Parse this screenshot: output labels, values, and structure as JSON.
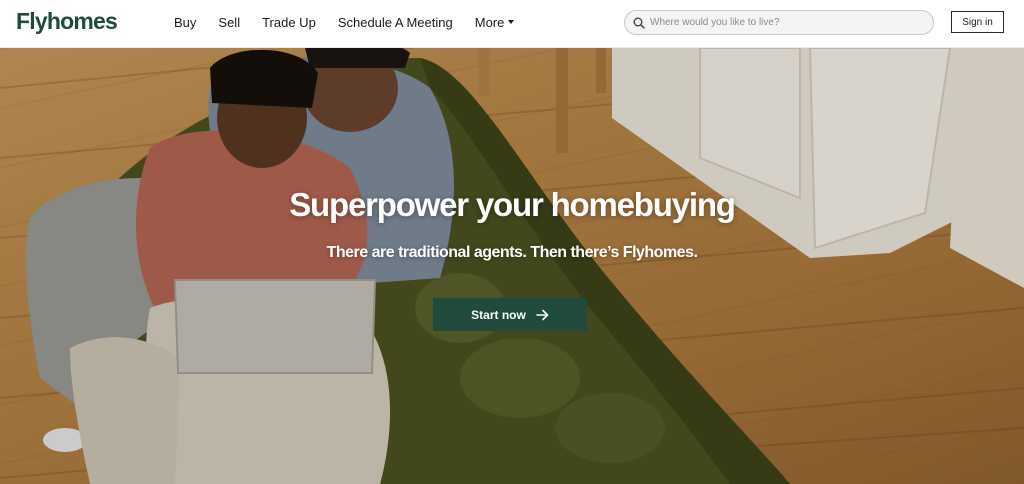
{
  "brand": {
    "name": "Flyhomes",
    "color": "#1f4a3c"
  },
  "nav": {
    "items": [
      {
        "label": "Buy"
      },
      {
        "label": "Sell"
      },
      {
        "label": "Trade Up"
      },
      {
        "label": "Schedule A Meeting"
      },
      {
        "label": "More",
        "has_dropdown": true
      }
    ]
  },
  "search": {
    "placeholder": "Where would you like to live?",
    "icon": "search-icon"
  },
  "auth": {
    "signin_label": "Sign in"
  },
  "hero": {
    "title": "Superpower your homebuying",
    "subtitle": "There are traditional agents. Then there’s Flyhomes.",
    "cta_label": "Start now",
    "cta_icon": "arrow-right-icon",
    "cta_color": "#1f4a3c",
    "image": "couple-on-sofa-with-laptop"
  }
}
